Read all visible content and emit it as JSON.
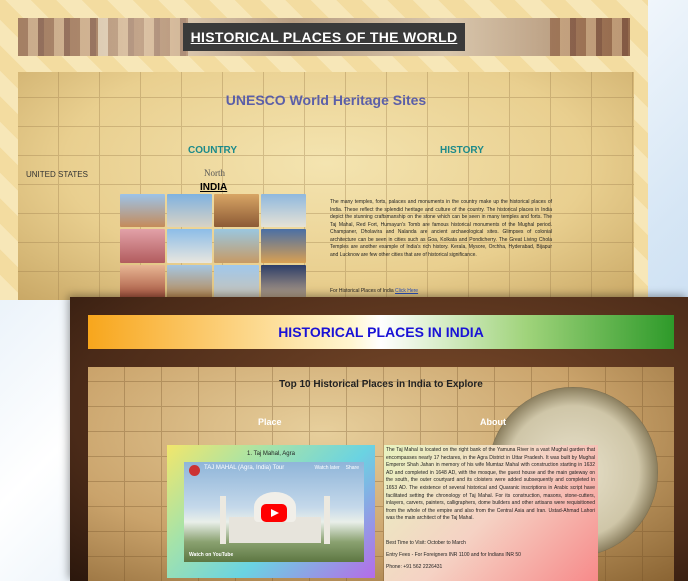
{
  "page1": {
    "banner_title": "HISTORICAL PLACES OF THE WORLD",
    "heading": "UNESCO World Heritage Sites",
    "tab_country": "COUNTRY",
    "tab_history": "HISTORY",
    "map_label_us": "UNITED STATES",
    "map_label_north": "North",
    "country_label": "INDIA",
    "description": "The many temples, forts, palaces and monuments in the country make up the historical places of India. These reflect the splendid heritage and culture of the country. The historical places in India depict the stunning craftsmanship on the stone which can be seen in many temples and forts. The Taj Mahal, Red Fort, Humayun's Tomb are famous historical monuments of the Mughal period. Champaner, Dholavira and Nalanda are ancient archaeological sites. Glimpses of colonial architecture can be seen in cities such as Goa, Kolkata and Pondicherry. The Great Living Chola Temples are another example of India's rich history. Kerala, Mysore, Orchha, Hyderabad, Bijapur and Lucknow are few other cities that are of historical significance.",
    "link_prefix": "For Historical Places of India",
    "link_text": "Click Here"
  },
  "page2": {
    "header_title": "HISTORICAL PLACES IN INDIA",
    "subheading": "Top 10 Historical Places in India to Explore",
    "col_place": "Place",
    "col_about": "About",
    "place_title": "1. Taj Mahal, Agra",
    "video": {
      "title": "TAJ MAHAL (Agra, India) Tour",
      "watch_later": "Watch later",
      "share": "Share",
      "watch_on": "Watch on",
      "youtube": "YouTube"
    },
    "about_text": "The Taj Mahal is located on the right bank of the Yamuna River in a vast Mughal garden that encompasses nearly 17 hectares, in the Agra District in Uttar Pradesh. It was built by Mughal Emperor Shah Jahan in memory of his wife Mumtaz Mahal with construction starting in 1632 AD and completed in 1648 AD, with the mosque, the guest house and the main gateway on the south, the outer courtyard and its cloisters were added subsequently and completed in 1653 AD. The existence of several historical and Quaranic inscriptions in Arabic script have facilitated setting the chronology of Taj Mahal. For its construction, masons, stone-cutters, inlayers, carvers, painters, calligraphers, dome builders and other artisans were requisitioned from the whole of the empire and also from the Central Asia and Iran. Ustad-Ahmad Lahori was the main architect of the Taj Mahal.",
    "best_time": "Best Time to Visit: October to March",
    "entry_fee": "Entry Fees - For Foreigners INR 1100 and for Indians INR 50",
    "phone": "Phone: +91 562 2226431"
  },
  "colors": {
    "unesco_heading": "#5b5fa8",
    "tabs": "#1c8a8a",
    "india_header_text": "#1a12d6",
    "youtube_red": "#ff0000"
  },
  "icons": [
    "play-button-icon",
    "channel-avatar-icon",
    "watch-later-icon",
    "share-icon"
  ]
}
